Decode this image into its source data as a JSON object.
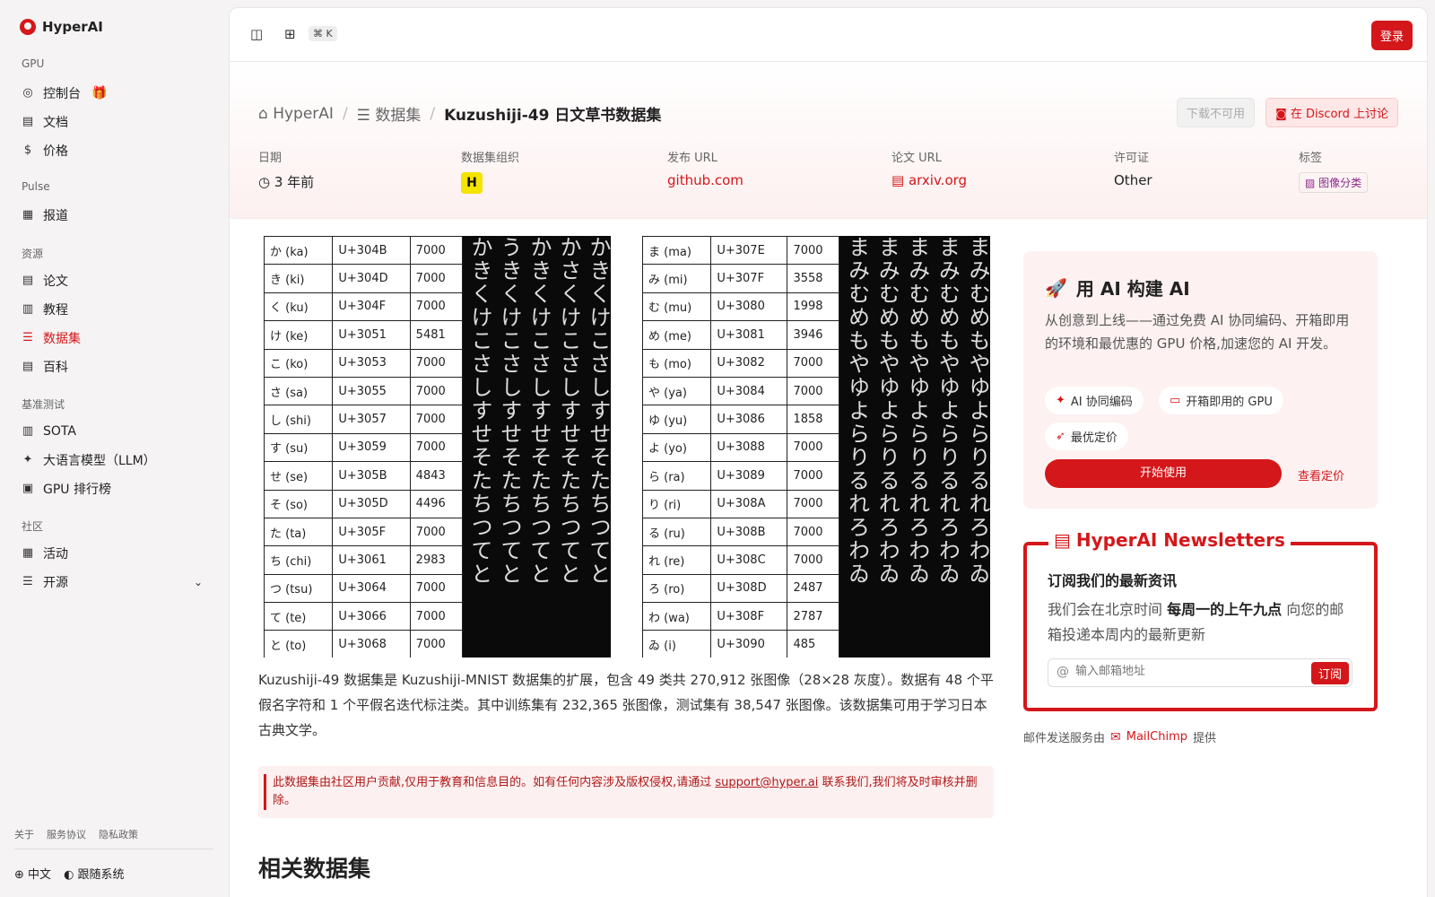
{
  "sidebar": {
    "brand": "HyperAI",
    "sections": {
      "gpu": "GPU",
      "pulse": "Pulse",
      "resources": "资源",
      "bench": "基准测试",
      "community": "社区"
    },
    "items": {
      "console": "控制台",
      "docs": "文档",
      "pricing": "价格",
      "news": "报道",
      "papers": "论文",
      "tutorials": "教程",
      "datasets": "数据集",
      "wiki": "百科",
      "sota": "SOTA",
      "llm": "大语言模型（LLM）",
      "gpu_rank": "GPU 排行榜",
      "events": "活动",
      "opensource": "开源"
    },
    "footer": {
      "about": "关于",
      "terms": "服务协议",
      "privacy": "隐私政策",
      "lang": "中文",
      "theme": "跟随系统"
    }
  },
  "topbar": {
    "kbd": "⌘ K",
    "login": "登录"
  },
  "hero": {
    "crumbs": {
      "home": "HyperAI",
      "datasets": "数据集",
      "current": "Kuzushiji-49 日文草书数据集"
    },
    "download": "下载不可用",
    "discord": "在 Discord 上讨论",
    "meta": {
      "date_label": "日期",
      "date": "3 年前",
      "org_label": "数据集组织",
      "url_label": "发布 URL",
      "url": "github.com",
      "paper_label": "论文 URL",
      "paper": "arxiv.org",
      "license_label": "许可证",
      "license": "Other",
      "tags_label": "标签",
      "tag": "图像分类"
    }
  },
  "table_left": [
    [
      "か (ka)",
      "U+304B",
      "7000"
    ],
    [
      "き (ki)",
      "U+304D",
      "7000"
    ],
    [
      "く (ku)",
      "U+304F",
      "7000"
    ],
    [
      "け (ke)",
      "U+3051",
      "5481"
    ],
    [
      "こ (ko)",
      "U+3053",
      "7000"
    ],
    [
      "さ (sa)",
      "U+3055",
      "7000"
    ],
    [
      "し (shi)",
      "U+3057",
      "7000"
    ],
    [
      "す (su)",
      "U+3059",
      "7000"
    ],
    [
      "せ (se)",
      "U+305B",
      "4843"
    ],
    [
      "そ (so)",
      "U+305D",
      "4496"
    ],
    [
      "た (ta)",
      "U+305F",
      "7000"
    ],
    [
      "ち (chi)",
      "U+3061",
      "2983"
    ],
    [
      "つ (tsu)",
      "U+3064",
      "7000"
    ],
    [
      "て (te)",
      "U+3066",
      "7000"
    ],
    [
      "と (to)",
      "U+3068",
      "7000"
    ]
  ],
  "table_right": [
    [
      "ま (ma)",
      "U+307E",
      "7000"
    ],
    [
      "み (mi)",
      "U+307F",
      "3558"
    ],
    [
      "む (mu)",
      "U+3080",
      "1998"
    ],
    [
      "め (me)",
      "U+3081",
      "3946"
    ],
    [
      "も (mo)",
      "U+3082",
      "7000"
    ],
    [
      "や (ya)",
      "U+3084",
      "7000"
    ],
    [
      "ゆ (yu)",
      "U+3086",
      "1858"
    ],
    [
      "よ (yo)",
      "U+3088",
      "7000"
    ],
    [
      "ら (ra)",
      "U+3089",
      "7000"
    ],
    [
      "り (ri)",
      "U+308A",
      "7000"
    ],
    [
      "る (ru)",
      "U+308B",
      "7000"
    ],
    [
      "れ (re)",
      "U+308C",
      "7000"
    ],
    [
      "ろ (ro)",
      "U+308D",
      "2487"
    ],
    [
      "わ (wa)",
      "U+308F",
      "2787"
    ],
    [
      "ゐ (i)",
      "U+3090",
      "485"
    ]
  ],
  "strip_left": [
    "かきくけこさしすせそたちつてと",
    "うきくけこさしすせそたちつてと",
    "かきくけこさしすせそたちつてと",
    "かさくけこさしすせそたちつてと",
    "かきくけこさしすせそたちつてと"
  ],
  "strip_right": [
    "まみむめもやゆよらりるれろわゐ",
    "まみむめもやゆよらりるれろわゐ",
    "まみむめもやゆよらりるれろわゐ",
    "まみむめもやゆよらりるれろわゐ",
    "まみむめもやゆよらりるれろわゐ"
  ],
  "content": {
    "description": "Kuzushiji-49 数据集是 Kuzushiji-MNIST 数据集的扩展，包含 49 类共 270,912 张图像（28×28 灰度）。数据有 48 个平假名字符和 1 个平假名迭代标注类。其中训练集有 232,365 张图像，测试集有 38,547 张图像。该数据集可用于学习日本古典文学。",
    "notice_pre": "此数据集由社区用户贡献,仅用于教育和信息目的。如有任何内容涉及版权侵权,请通过 ",
    "notice_link": "support@hyper.ai",
    "notice_post": " 联系我们,我们将及时审核并删除。",
    "related": "相关数据集"
  },
  "card": {
    "title": "用 AI 构建 AI",
    "text": "从创意到上线——通过免费 AI 协同编码、开箱即用的环境和最优惠的 GPU 价格,加速您的 AI 开发。",
    "chip1": "AI 协同编码",
    "chip2": "开箱即用的 GPU",
    "chip3": "最优定价",
    "cta": "开始使用",
    "pricing": "查看定价"
  },
  "newsletter": {
    "legend": "HyperAI Newsletters",
    "title": "订阅我们的最新资讯",
    "text_pre": "我们会在北京时间 ",
    "text_bold": "每周一的上午九点",
    "text_post": " 向您的邮箱投递本周内的最新更新",
    "placeholder": "输入邮箱地址",
    "subscribe": "订阅"
  },
  "mail": {
    "pre": "邮件发送服务由",
    "brand": "MailChimp",
    "post": "提供"
  },
  "colors": {
    "accent": "#d4171a",
    "sidebar_bg": "#f5f3f3"
  }
}
